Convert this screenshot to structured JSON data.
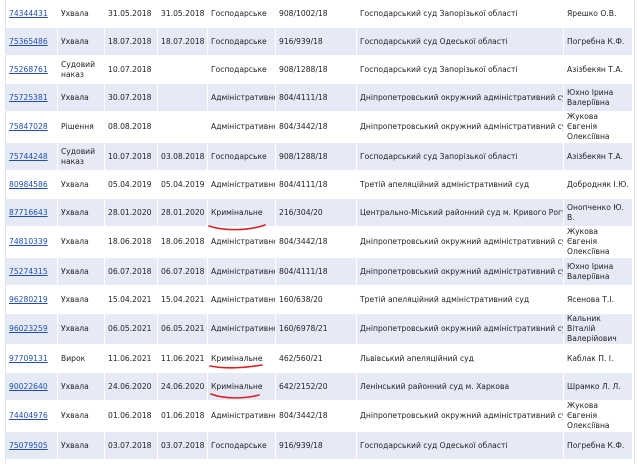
{
  "accent": "#1f4fb0",
  "row_bg_alt": "#e6eaf7",
  "annotation_color": "#d92020",
  "rows": [
    {
      "id": "74344431",
      "type": "Ухвала",
      "reg_date": "31.05.2018",
      "adopt_date": "31.05.2018",
      "form": "Господарське",
      "case": "908/1002/18",
      "court": "Господарський суд Запорізької області",
      "judge": "Ярешко О.В."
    },
    {
      "id": "75365486",
      "type": "Ухвала",
      "reg_date": "18.07.2018",
      "adopt_date": "18.07.2018",
      "form": "Господарське",
      "case": "916/939/18",
      "court": "Господарський суд Одеської області",
      "judge": "Погребна К.Ф."
    },
    {
      "id": "75268761",
      "type": "Судовий наказ",
      "reg_date": "10.07.2018",
      "adopt_date": "",
      "form": "Господарське",
      "case": "908/1288/18",
      "court": "Господарський суд Запорізької області",
      "judge": "Азізбекян Т.А."
    },
    {
      "id": "75725381",
      "type": "Ухвала",
      "reg_date": "30.07.2018",
      "adopt_date": "",
      "form": "Адміністративне",
      "case": "804/4111/18",
      "court": "Дніпропетровський окружний адміністративний суд",
      "judge": "Юхно Ірина Валеріївна"
    },
    {
      "id": "75847028",
      "type": "Рішення",
      "reg_date": "08.08.2018",
      "adopt_date": "",
      "form": "Адміністративне",
      "case": "804/3442/18",
      "court": "Дніпропетровський окружний адміністративний суд",
      "judge": "Жукова Євгенія Олексіївна"
    },
    {
      "id": "75744248",
      "type": "Судовий наказ",
      "reg_date": "10.07.2018",
      "adopt_date": "03.08.2018",
      "form": "Господарське",
      "case": "908/1288/18",
      "court": "Господарський суд Запорізької області",
      "judge": "Азізбекян Т.А."
    },
    {
      "id": "80984586",
      "type": "Ухвала",
      "reg_date": "05.04.2019",
      "adopt_date": "05.04.2019",
      "form": "Адміністративне",
      "case": "804/4111/18",
      "court": "Третій апеляційний адміністративний суд",
      "judge": "Добродняк І.Ю."
    },
    {
      "id": "87716643",
      "type": "Ухвала",
      "reg_date": "28.01.2020",
      "adopt_date": "28.01.2020",
      "form": "Кримінальне",
      "case": "216/304/20",
      "court": "Центрально-Міський районний суд м. Кривого Рогу",
      "judge": "Онопченко Ю. В."
    },
    {
      "id": "74810339",
      "type": "Ухвала",
      "reg_date": "18.06.2018",
      "adopt_date": "18.06.2018",
      "form": "Адміністративне",
      "case": "804/3442/18",
      "court": "Дніпропетровський окружний адміністративний суд",
      "judge": "Жукова Євгенія Олексіївна"
    },
    {
      "id": "75274315",
      "type": "Ухвала",
      "reg_date": "06.07.2018",
      "adopt_date": "06.07.2018",
      "form": "Адміністративне",
      "case": "804/4111/18",
      "court": "Дніпропетровський окружний адміністративний суд",
      "judge": "Юхно Ірина Валеріївна"
    },
    {
      "id": "96280219",
      "type": "Ухвала",
      "reg_date": "15.04.2021",
      "adopt_date": "15.04.2021",
      "form": "Адміністративне",
      "case": "160/638/20",
      "court": "Третій апеляційний адміністративний суд",
      "judge": "Ясенова Т.І."
    },
    {
      "id": "96023259",
      "type": "Ухвала",
      "reg_date": "06.05.2021",
      "adopt_date": "06.05.2021",
      "form": "Адміністративне",
      "case": "160/6978/21",
      "court": "Дніпропетровський окружний адміністративний суд",
      "judge": "Кальник Віталій Валерійович"
    },
    {
      "id": "97709131",
      "type": "Вирок",
      "reg_date": "11.06.2021",
      "adopt_date": "11.06.2021",
      "form": "Кримінальне",
      "case": "462/560/21",
      "court": "Львівський апеляційний суд",
      "judge": "Каблак П. І."
    },
    {
      "id": "90022640",
      "type": "Ухвала",
      "reg_date": "24.06.2020",
      "adopt_date": "24.06.2020",
      "form": "Кримінальне",
      "case": "642/2152/20",
      "court": "Ленінський районний суд м. Харкова",
      "judge": "Шрамко Л. Л."
    },
    {
      "id": "74404976",
      "type": "Ухвала",
      "reg_date": "01.06.2018",
      "adopt_date": "01.06.2018",
      "form": "Адміністративне",
      "case": "804/3442/18",
      "court": "Дніпропетровський окружний адміністративний суд",
      "judge": "Жукова Євгенія Олексіївна"
    },
    {
      "id": "75079505",
      "type": "Ухвала",
      "reg_date": "03.07.2018",
      "adopt_date": "03.07.2018",
      "form": "Господарське",
      "case": "916/939/18",
      "court": "Господарський суд Одеської області",
      "judge": "Погребна К.Ф."
    }
  ]
}
